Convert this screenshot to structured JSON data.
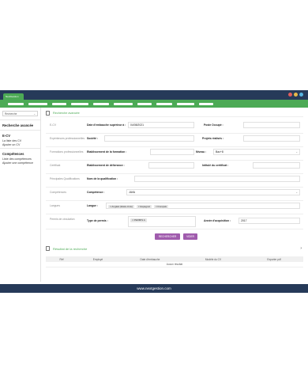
{
  "window": {
    "tab_label": "NextGestion",
    "dot_colors": [
      "#e05d5d",
      "#e6b84a",
      "#56b4e0"
    ]
  },
  "sidebar": {
    "search_select": "Recherche",
    "groups": [
      {
        "heading": "Recherche avancée",
        "items": []
      },
      {
        "heading": "E-CV",
        "items": [
          "La liste des CV",
          "Ajouter un CV"
        ]
      },
      {
        "heading": "Compétences",
        "items": [
          "Liste des compétences",
          "Ajouter une compétence"
        ]
      }
    ]
  },
  "page": {
    "title": "Recherche avancée"
  },
  "form": {
    "rows": [
      {
        "section": "E-CV",
        "l1": "Date d'embauche supérieur à :",
        "v1": "04/08/2021",
        "l2": "Poste Occupé :",
        "v2": ""
      },
      {
        "section": "Expériences professionnelles",
        "l1": "Société :",
        "v1": "",
        "l2": "Projets réalisés :",
        "v2": ""
      },
      {
        "section": "Formations professionnelles",
        "l1": "Etablissement de la formation :",
        "v1": "",
        "l2": "Niveau :",
        "v2": "Bac+8"
      },
      {
        "section": "Certificat",
        "l1": "Etablissement de délivrance :",
        "v1": "",
        "l2": "Intitulé du certificat :",
        "v2": ""
      },
      {
        "section": "Principales Qualifications",
        "l1": "Nom de la qualification :",
        "v1": "",
        "l2": "",
        "v2": ""
      },
      {
        "section": "Compétences",
        "l1": "Compétence :",
        "v1": "JAVA",
        "l2": "",
        "v2": ""
      },
      {
        "section": "Langues",
        "l1": "Langue :",
        "chips": [
          "Anglais (Etats-Unis)",
          "Espagnol",
          "Français"
        ]
      },
      {
        "section": "Permis de circulation",
        "l1": "Type de permis :",
        "chips": [
          "PERMIS A"
        ],
        "l2": "Année d'acquisition :",
        "v2": "2017"
      }
    ]
  },
  "buttons": {
    "search": "RECHERCHER",
    "reset": "VIDER"
  },
  "results": {
    "title": "Résultat de la recherche",
    "columns": [
      "Réf",
      "Employé",
      "Date d'embauche",
      "Modèle du CV",
      "Exporter pdf"
    ],
    "empty": "Aucun résultat"
  },
  "footer": {
    "text": "www.nextgestion.com"
  }
}
